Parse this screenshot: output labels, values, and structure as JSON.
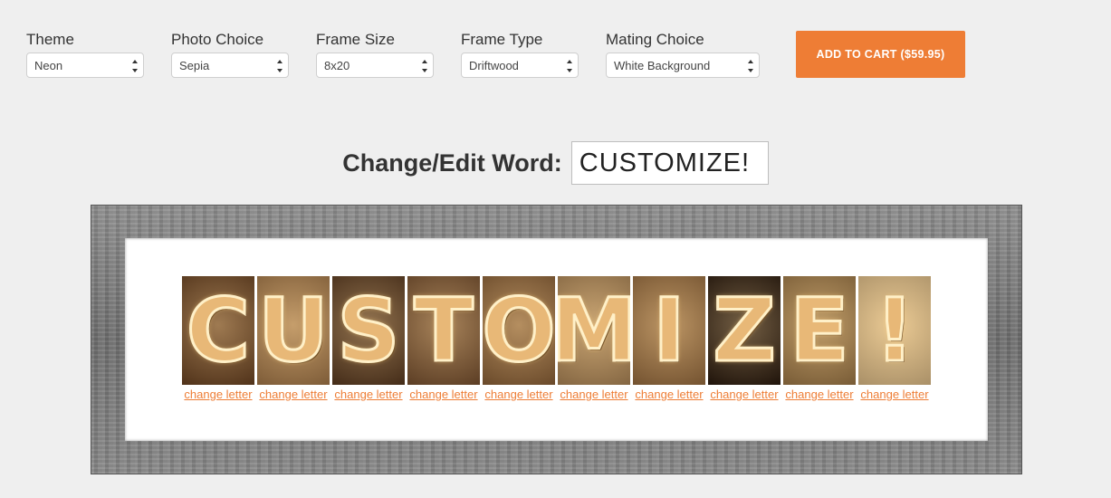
{
  "options": [
    {
      "label": "Theme",
      "value": "Neon"
    },
    {
      "label": "Photo Choice",
      "value": "Sepia"
    },
    {
      "label": "Frame Size",
      "value": "8x20"
    },
    {
      "label": "Frame Type",
      "value": "Driftwood"
    },
    {
      "label": "Mating Choice",
      "value": "White Background"
    }
  ],
  "cart": {
    "label": "ADD TO CART ($59.95)"
  },
  "edit": {
    "label": "Change/Edit Word:",
    "value": "CUSTOMIZE!"
  },
  "letters": [
    {
      "char": "C",
      "bg": "#6b4322",
      "link": "change letter"
    },
    {
      "char": "U",
      "bg": "#a77a4a",
      "link": "change letter"
    },
    {
      "char": "S",
      "bg": "#5a3a20",
      "link": "change letter"
    },
    {
      "char": "T",
      "bg": "#7a5230",
      "link": "change letter"
    },
    {
      "char": "O",
      "bg": "#8d6238",
      "link": "change letter"
    },
    {
      "char": "M",
      "bg": "#b08858",
      "link": "change letter"
    },
    {
      "char": "I",
      "bg": "#9a6e40",
      "link": "change letter"
    },
    {
      "char": "Z",
      "bg": "#2a1a0e",
      "link": "change letter"
    },
    {
      "char": "E",
      "bg": "#a07a48",
      "link": "change letter"
    },
    {
      "char": "!",
      "bg": "#e2c08a",
      "link": "change letter"
    }
  ],
  "colors": {
    "accent": "#ee7d35",
    "background": "#efefef"
  },
  "footer": {
    "text": ""
  }
}
